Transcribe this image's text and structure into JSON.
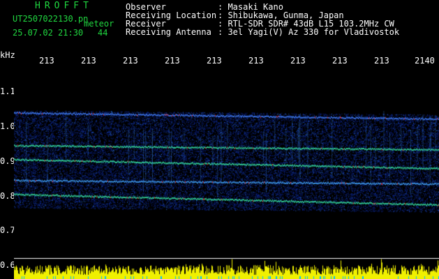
{
  "header": {
    "app_title": "HROFFT",
    "filename": "UT2507022130.pn",
    "mode": "meteor",
    "datetime": "25.07.02 21:30",
    "count": "44"
  },
  "station": {
    "labels": [
      "Observer",
      "Receiving Location",
      "Receiver",
      "Receiving Antenna"
    ],
    "values": [
      ": Masaki Kano",
      ": Shibukawa, Gunma, Japan",
      ": RTL-SDR SDR# 43dB L15 103.2MHz CW",
      ": 3el Yagi(V) Az 330 for Vladivostok"
    ]
  },
  "axis": {
    "unit": "kHz",
    "time_ticks": [
      "213",
      "213",
      "213",
      "213",
      "213",
      "213",
      "213",
      "213",
      "213",
      "2140"
    ],
    "freq_ticks": [
      "1.1",
      "1.0",
      "0.9",
      "0.8",
      "0.7",
      "0.6"
    ]
  },
  "colors": {
    "text_green": "#20d840",
    "text_white": "#ffffff",
    "noise_blue": "#1030a0",
    "signal_green": "#30c890",
    "signal_red": "#e03030",
    "amplitude_yellow": "#f0f000",
    "grid_line": "#ffffff"
  }
}
